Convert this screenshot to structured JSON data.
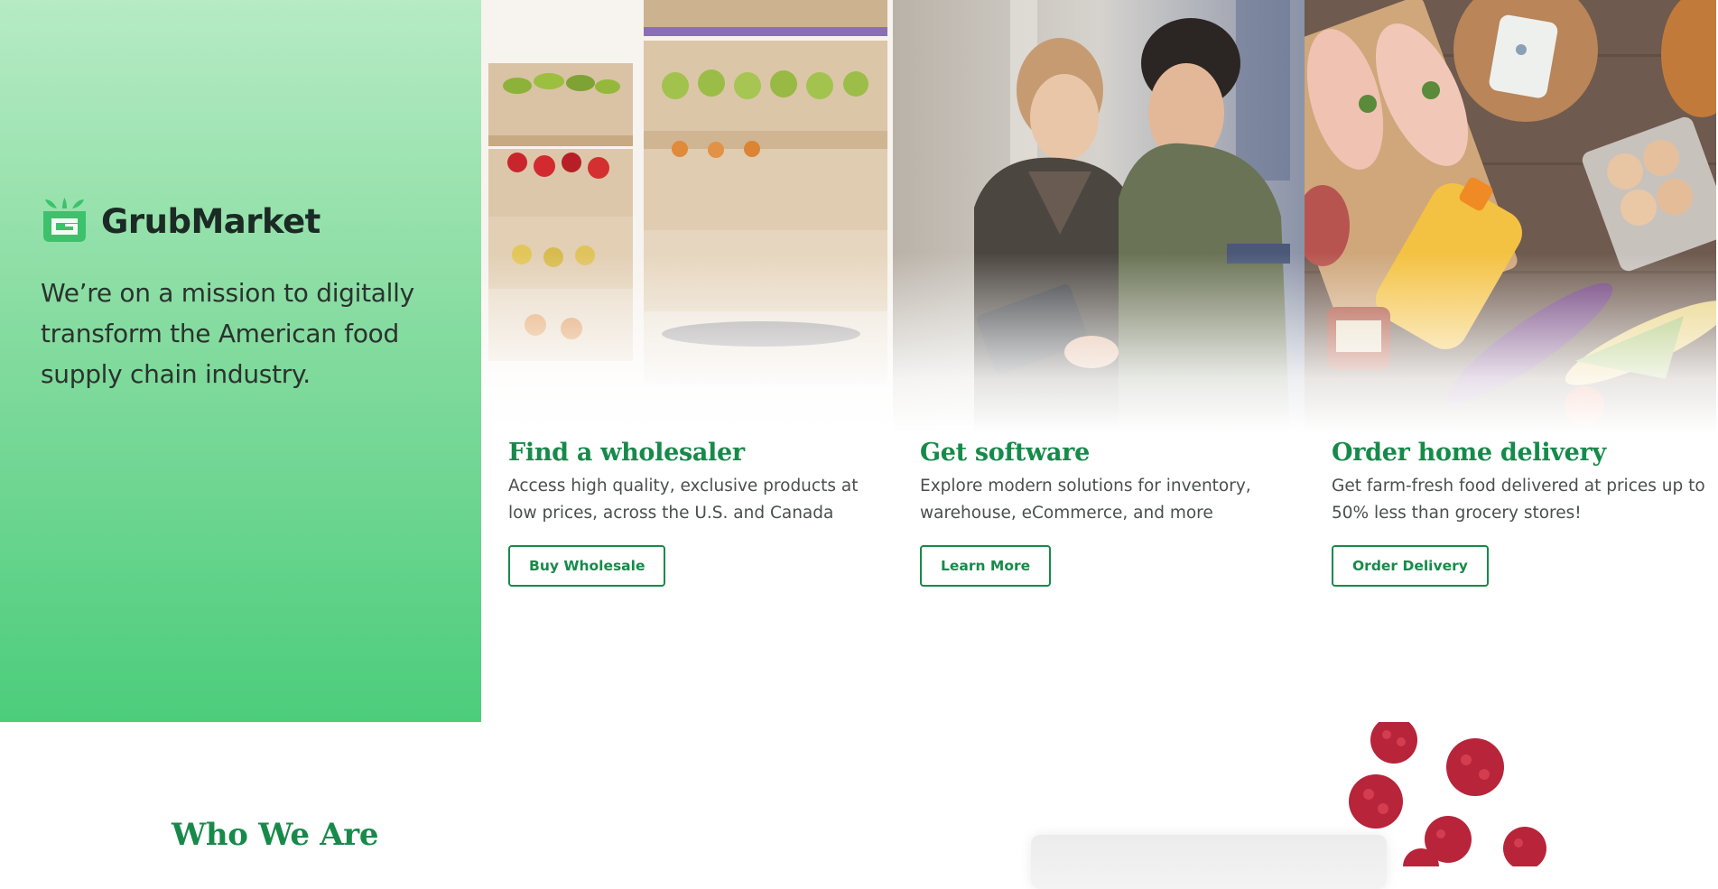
{
  "brand": {
    "name": "GrubMarket",
    "logo_icon": "basket-sprout-icon",
    "color": "#3cc26a"
  },
  "hero": {
    "mission": "We’re on a mission to digitally transform the American food supply chain industry."
  },
  "cards": [
    {
      "image": "produce-crates-photo",
      "title": "Find a wholesaler",
      "description": "Access high quality, exclusive products at low prices, across the U.S. and Canada",
      "button": "Buy Wholesale"
    },
    {
      "image": "warehouse-workers-tablet-photo",
      "title": "Get software",
      "description": "Explore modern solutions for inventory, warehouse, eCommerce, and more",
      "button": "Learn More"
    },
    {
      "image": "groceries-on-table-photo",
      "title": "Order home delivery",
      "description": "Get farm-fresh food delivered at prices up to 50% less than grocery stores!",
      "button": "Order Delivery"
    }
  ],
  "who_we_are": {
    "title": "Who We Are"
  },
  "colors": {
    "accent_green": "#178a4a",
    "hero_gradient_top": "#b6ebc4",
    "hero_gradient_bottom": "#4ccd7c",
    "body_text": "#4a4f4c"
  }
}
